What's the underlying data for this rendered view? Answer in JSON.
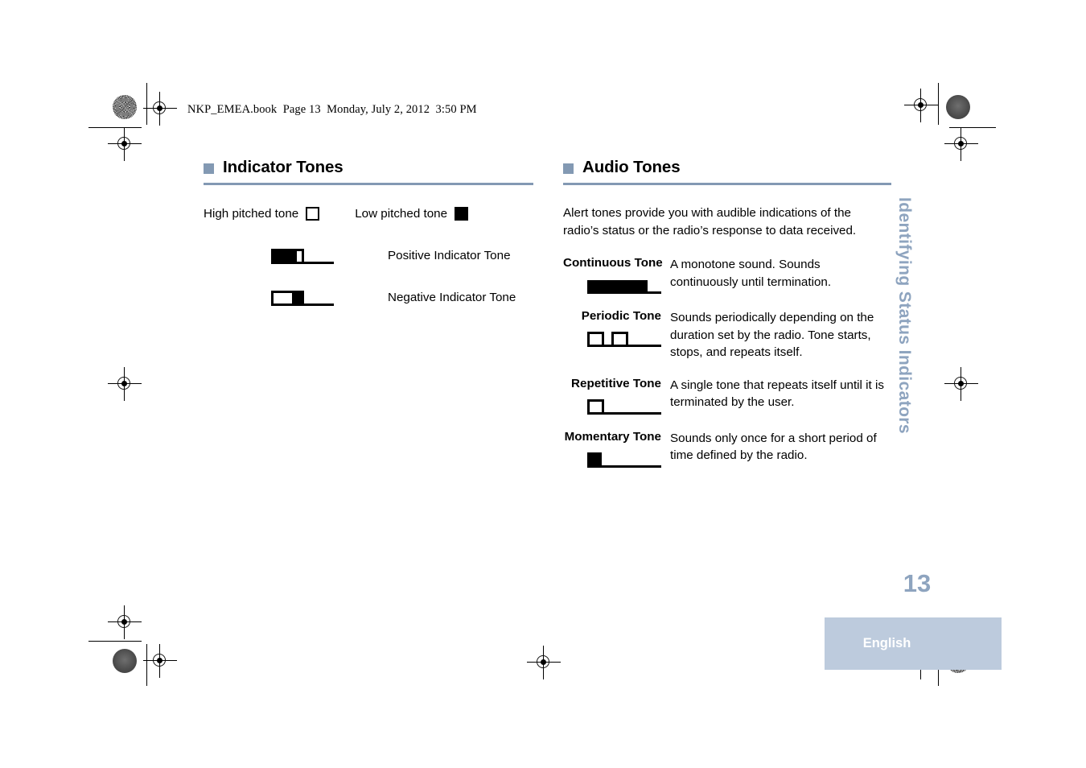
{
  "document": {
    "book_header": "NKP_EMEA.book  Page 13  Monday, July 2, 2012  3:50 PM",
    "side_tab": "Identifying Status Indicators",
    "page_number": "13",
    "language": "English",
    "accent_color": "#8399b3",
    "tab_color": "#bdcbdd",
    "page_number_color": "#8ea4bf"
  },
  "left_column": {
    "heading": "Indicator Tones",
    "legend": [
      {
        "label": "High pitched tone",
        "swatch": "open-square"
      },
      {
        "label": "Low pitched tone",
        "swatch": "filled-square"
      }
    ],
    "indicators": [
      {
        "label": "Positive Indicator Tone",
        "pattern": "filled-then-open"
      },
      {
        "label": "Negative Indicator Tone",
        "pattern": "open-then-filled"
      }
    ]
  },
  "right_column": {
    "heading": "Audio Tones",
    "intro": "Alert tones provide you with audible indications of the radio’s status or the radio’s response to data received.",
    "tones": [
      {
        "name": "Continuous Tone",
        "description": "A monotone sound. Sounds continuously until termination.",
        "waveform": "long-filled-bar"
      },
      {
        "name": "Periodic Tone",
        "description": "Sounds periodically depending on the duration set by the radio. Tone starts, stops, and repeats itself.",
        "waveform": "two-open-squares"
      },
      {
        "name": "Repetitive Tone",
        "description": "A single tone that repeats itself until it is terminated by the user.",
        "waveform": "one-open-square"
      },
      {
        "name": "Momentary Tone",
        "description": "Sounds only once for a short period of time defined by the radio.",
        "waveform": "one-filled-square"
      }
    ]
  }
}
